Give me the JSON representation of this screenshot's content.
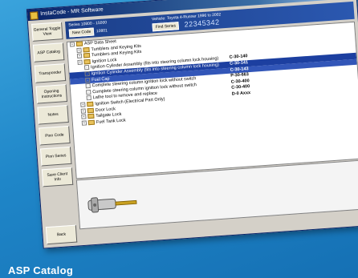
{
  "window": {
    "title": "InstaCode - MR Software",
    "buttons": [
      "_",
      "□",
      "×"
    ]
  },
  "sidebar": {
    "items": [
      {
        "label": "General Toggle View"
      },
      {
        "label": "ASP Catalog"
      },
      {
        "label": "Transponder"
      },
      {
        "label": "Opening Instructions"
      },
      {
        "label": "Notes"
      },
      {
        "label": "Pinn Code"
      },
      {
        "label": "Pinn Series"
      },
      {
        "label": "Save Client Info"
      },
      {
        "label": "Back"
      }
    ]
  },
  "infobar": {
    "series_label": "Series 10800 - 15000",
    "mini_button": "New Code",
    "code_label": "10801",
    "vehicle_label": "Vehicle: Toyota 4-Runner 1996 to 2002",
    "key_button": "Find Series",
    "big_code": "22345342"
  },
  "tree": {
    "rows": [
      {
        "indent": 0,
        "type": "folder",
        "text": "ASP Data Sheet",
        "code": "",
        "state": ""
      },
      {
        "indent": 1,
        "type": "folder",
        "text": "Tumblers and Keying Kits",
        "code": "",
        "state": ""
      },
      {
        "indent": 1,
        "type": "folder",
        "text": "Tumblers and Keying Kits",
        "code": "",
        "state": ""
      },
      {
        "indent": 1,
        "type": "folder",
        "text": "Ignition Lock",
        "code": "",
        "state": ""
      },
      {
        "indent": 2,
        "type": "item",
        "text": "Ignition Cylinder Assembly (fits into steering column lock housing)",
        "code": "C-30-140",
        "state": ""
      },
      {
        "indent": 2,
        "type": "item",
        "text": "Ignition Cylinder Assembly (fits into steering column lock housing)",
        "code": "C-30-141",
        "state": "sel"
      },
      {
        "indent": 2,
        "type": "item",
        "text": "Fuel Cap",
        "code": "C-30-143",
        "state": "sel2"
      },
      {
        "indent": 2,
        "type": "item",
        "text": "Complete steering column ignition lock without switch",
        "code": "P-30-663",
        "state": ""
      },
      {
        "indent": 2,
        "type": "item",
        "text": "Complete steering column ignition lock without switch",
        "code": "C-30-400",
        "state": ""
      },
      {
        "indent": 2,
        "type": "item",
        "text": "Lathe tool to remove and replace",
        "code": "C-30-400",
        "state": ""
      },
      {
        "indent": 1,
        "type": "folder",
        "text": "Ignition Switch (Electrical Part Only)",
        "code": "D-0 Axxx",
        "state": ""
      },
      {
        "indent": 1,
        "type": "folder",
        "text": "Door Lock",
        "code": "",
        "state": ""
      },
      {
        "indent": 1,
        "type": "folder",
        "text": "Tailgate Lock",
        "code": "",
        "state": ""
      },
      {
        "indent": 1,
        "type": "folder",
        "text": "Fuel Tank Lock",
        "code": "",
        "state": ""
      }
    ]
  },
  "image_panel": {
    "icon": "key-lock-icon"
  },
  "footer": {
    "caption": "ASP Catalog"
  }
}
